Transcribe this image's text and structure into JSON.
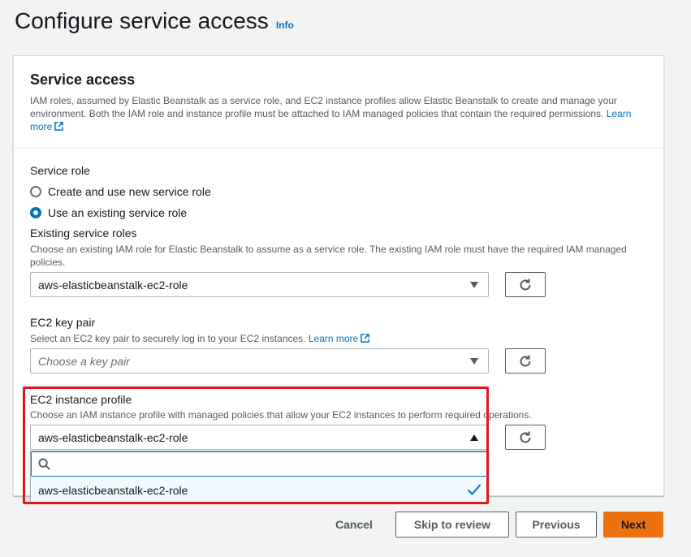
{
  "header": {
    "title": "Configure service access",
    "info": "Info"
  },
  "service_access": {
    "title": "Service access",
    "description": "IAM roles, assumed by Elastic Beanstalk as a service role, and EC2 instance profiles allow Elastic Beanstalk to create and manage your environment. Both the IAM role and instance profile must be attached to IAM managed policies that contain the required permissions.",
    "learn_more": "Learn more"
  },
  "service_role": {
    "label": "Service role",
    "options": [
      {
        "label": "Create and use new service role",
        "selected": false
      },
      {
        "label": "Use an existing service role",
        "selected": true
      }
    ]
  },
  "existing_roles": {
    "label": "Existing service roles",
    "description": "Choose an existing IAM role for Elastic Beanstalk to assume as a service role. The existing IAM role must have the required IAM managed policies.",
    "value": "aws-elasticbeanstalk-ec2-role"
  },
  "key_pair": {
    "label": "EC2 key pair",
    "description": "Select an EC2 key pair to securely log in to your EC2 instances.",
    "learn_more": "Learn more",
    "placeholder": "Choose a key pair"
  },
  "instance_profile": {
    "label": "EC2 instance profile",
    "description": "Choose an IAM instance profile with managed policies that allow your EC2 instances to perform required operations.",
    "value": "aws-elasticbeanstalk-ec2-role",
    "filter_value": "",
    "option": "aws-elasticbeanstalk-ec2-role"
  },
  "footer": {
    "cancel": "Cancel",
    "skip": "Skip to review",
    "previous": "Previous",
    "next": "Next"
  },
  "colors": {
    "primary": "#ec7211",
    "link": "#0073bb",
    "highlight": "#e1171e"
  }
}
